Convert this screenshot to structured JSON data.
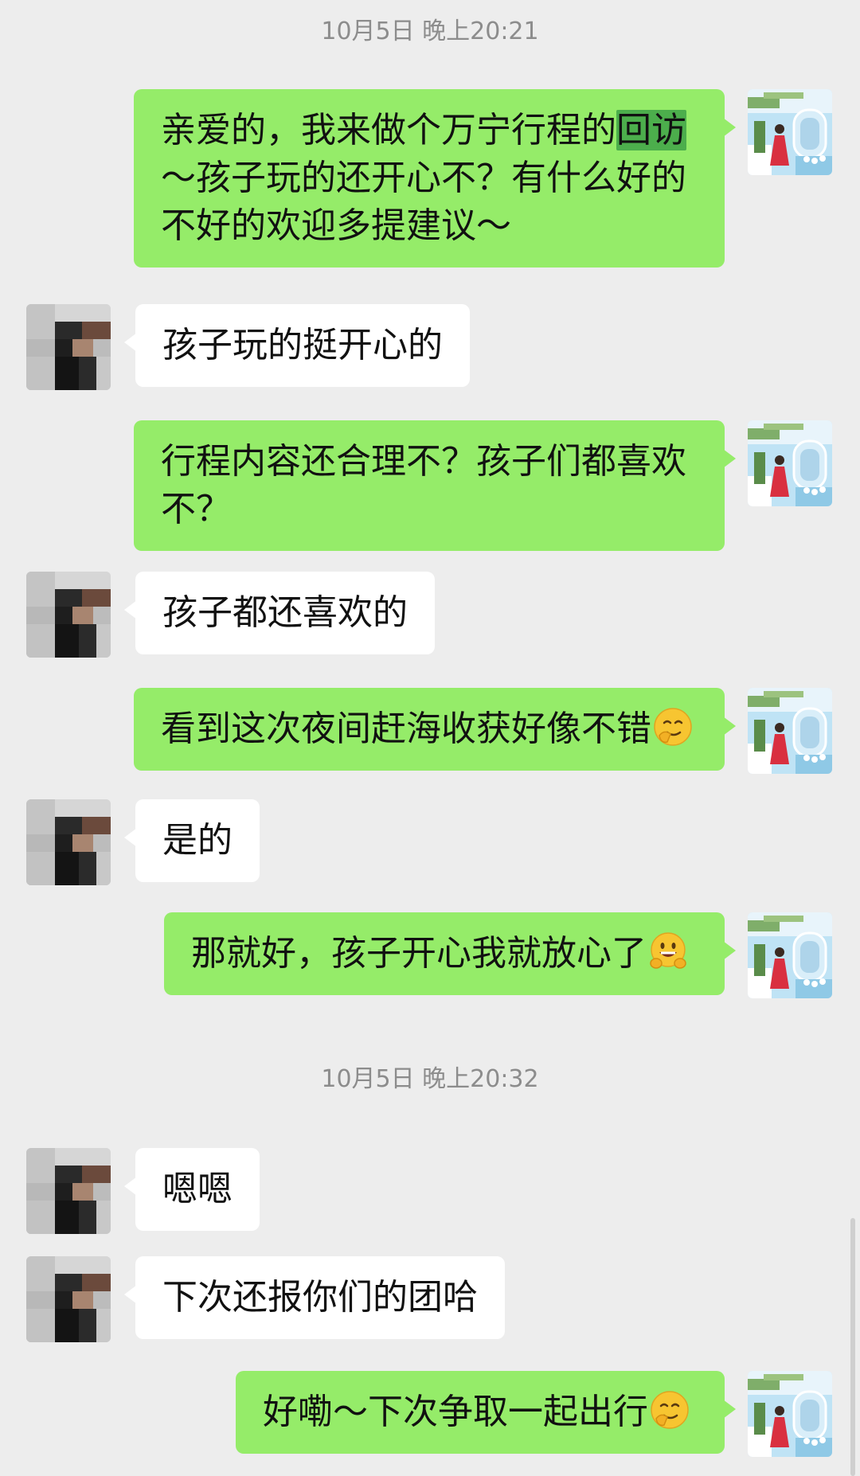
{
  "timestamps": [
    "10月5日 晚上20:21",
    "10月5日 晚上20:32"
  ],
  "messages": [
    {
      "side": "mine",
      "segments": [
        "亲爱的，我来做个万宁行程的",
        "回访",
        "\n～孩子玩的还开心不？有什么好的\n不好的欢迎多提建议～"
      ]
    },
    {
      "side": "theirs",
      "text": "孩子玩的挺开心的"
    },
    {
      "side": "mine",
      "text": "行程内容还合理不？孩子们都喜欢\n不？"
    },
    {
      "side": "theirs",
      "text": "孩子都还喜欢的"
    },
    {
      "side": "mine",
      "text": "看到这次夜间赶海收获好像不错",
      "emoji": "shy-smile-emoji"
    },
    {
      "side": "theirs",
      "text": "是的"
    },
    {
      "side": "mine",
      "text": "那就好，孩子开心我就放心了",
      "emoji": "grin-hands-emoji"
    },
    {
      "side": "theirs",
      "text": "嗯嗯"
    },
    {
      "side": "theirs",
      "text": "下次还报你们的团哈"
    },
    {
      "side": "mine",
      "text": "好嘞～下次争取一起出行",
      "emoji": "shy-smile-emoji"
    }
  ],
  "colors": {
    "background": "#ededed",
    "mine_bubble": "#95ec69",
    "theirs_bubble": "#ffffff",
    "highlight": "#4cae4c",
    "timestamp_text": "#8c8c8c"
  },
  "icons": {
    "my_avatar": "my-avatar-photo",
    "their_avatar": "pixelated-avatar"
  }
}
